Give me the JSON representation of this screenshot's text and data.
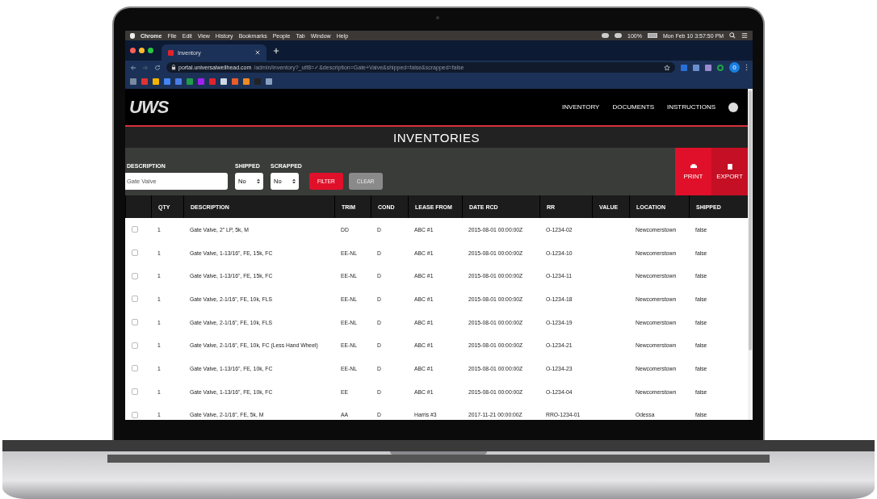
{
  "menubar": {
    "app": "Chrome",
    "items": [
      "File",
      "Edit",
      "View",
      "History",
      "Bookmarks",
      "People",
      "Tab",
      "Window",
      "Help"
    ],
    "battery": "100%",
    "clock": "Mon Feb 10  3:57:50 PM"
  },
  "browser": {
    "tab": {
      "title": "Inventory",
      "selected": true
    },
    "url_host": "portal.universalwellhead.com",
    "url_path": "/admin/inventory?_utf8=✓&description=Gate+Valve&shipped=false&scrapped=false",
    "profile": "0"
  },
  "app": {
    "logo": "UWS",
    "nav": [
      "INVENTORY",
      "DOCUMENTS",
      "INSTRUCTIONS"
    ],
    "title": "INVENTORIES"
  },
  "filters": {
    "description": {
      "label": "DESCRIPTION",
      "value": "Gate Valve"
    },
    "shipped": {
      "label": "SHIPPED",
      "value": "No"
    },
    "scrapped": {
      "label": "SCRAPPED",
      "value": "No"
    },
    "filter_button": "FILTER",
    "clear_button": "CLEAR",
    "print_button": "PRINT",
    "export_button": "EXPORT"
  },
  "table": {
    "columns": [
      "QTY",
      "DESCRIPTION",
      "TRIM",
      "COND",
      "LEASE FROM",
      "DATE RCD",
      "RR",
      "VALUE",
      "LOCATION",
      "SHIPPED"
    ],
    "rows": [
      {
        "checked": false,
        "qty": "1",
        "description": "Gate Valve, 2\" LP, 5k, M",
        "trim": "DD",
        "cond": "D",
        "lease_from": "ABC #1",
        "date_rcd": "2015-08-01 00:00:00Z",
        "rr": "O-1234-02",
        "location": "Newcomerstown",
        "shipped": "false"
      },
      {
        "checked": false,
        "qty": "1",
        "description": "Gate Valve, 1-13/16\", FE, 15k, FC",
        "trim": "EE-NL",
        "cond": "D",
        "lease_from": "ABC #1",
        "date_rcd": "2015-08-01 00:00:00Z",
        "rr": "O-1234-10",
        "location": "Newcomerstown",
        "shipped": "false"
      },
      {
        "checked": false,
        "qty": "1",
        "description": "Gate Valve, 1-13/16\", FE, 15k, FC",
        "trim": "EE-NL",
        "cond": "D",
        "lease_from": "ABC #1",
        "date_rcd": "2015-08-01 00:00:00Z",
        "rr": "O-1234-11",
        "location": "Newcomerstown",
        "shipped": "false"
      },
      {
        "checked": false,
        "qty": "1",
        "description": "Gate Valve, 2-1/16\", FE, 10k, FLS",
        "trim": "EE-NL",
        "cond": "D",
        "lease_from": "ABC #1",
        "date_rcd": "2015-08-01 00:00:00Z",
        "rr": "O-1234-18",
        "location": "Newcomerstown",
        "shipped": "false"
      },
      {
        "checked": false,
        "qty": "1",
        "description": "Gate Valve, 2-1/16\", FE, 10k, FLS",
        "trim": "EE-NL",
        "cond": "D",
        "lease_from": "ABC #1",
        "date_rcd": "2015-08-01 00:00:00Z",
        "rr": "O-1234-19",
        "location": "Newcomerstown",
        "shipped": "false"
      },
      {
        "checked": false,
        "qty": "1",
        "description": "Gate Valve, 2-1/16\", FE, 10k, FC (Less Hand Wheel)",
        "trim": "EE-NL",
        "cond": "D",
        "lease_from": "ABC #1",
        "date_rcd": "2015-08-01 00:00:00Z",
        "rr": "O-1234-21",
        "location": "Newcomerstown",
        "shipped": "false"
      },
      {
        "checked": false,
        "qty": "1",
        "description": "Gate Valve, 1-13/16\", FE, 10k, FC",
        "trim": "EE-NL",
        "cond": "D",
        "lease_from": "ABC #1",
        "date_rcd": "2015-08-01 00:00:00Z",
        "rr": "O-1234-23",
        "location": "Newcomerstown",
        "shipped": "false"
      },
      {
        "checked": false,
        "qty": "1",
        "description": "Gate Valve, 1-13/16\", FE, 10k, FC",
        "trim": "EE",
        "cond": "D",
        "lease_from": "ABC #1",
        "date_rcd": "2015-08-01 00:00:00Z",
        "rr": "O-1234-04",
        "location": "Newcomerstown",
        "shipped": "false"
      },
      {
        "checked": false,
        "qty": "1",
        "description": "Gate Valve, 2-1/16\", FE, 5k, M",
        "trim": "AA",
        "cond": "D",
        "lease_from": "Harris #3",
        "date_rcd": "2017-11-21 00:00:00Z",
        "rr": "RRO-1234-01",
        "location": "Odessa",
        "shipped": "false"
      }
    ]
  }
}
